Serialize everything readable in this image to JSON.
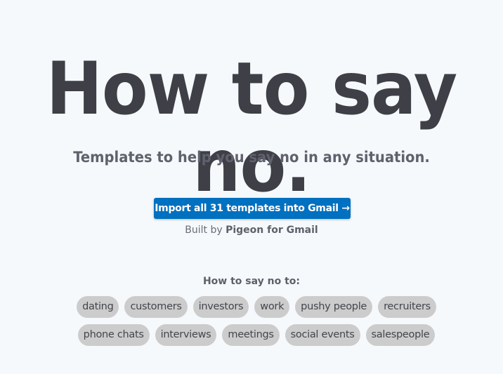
{
  "hero": {
    "title": "How to say no.",
    "subtitle": "Templates to help you say no in any situation."
  },
  "cta": {
    "label": "Import all 31 templates into Gmail →",
    "accent_color": "#0070c0"
  },
  "credit": {
    "prefix": "Built by",
    "brand": "Pigeon for Gmail"
  },
  "categories": {
    "heading": "How to say no to:",
    "row1": [
      "dating",
      "customers",
      "investors",
      "work",
      "pushy people",
      "recruiters"
    ],
    "row2": [
      "phone chats",
      "interviews",
      "meetings",
      "social events",
      "salespeople"
    ]
  }
}
